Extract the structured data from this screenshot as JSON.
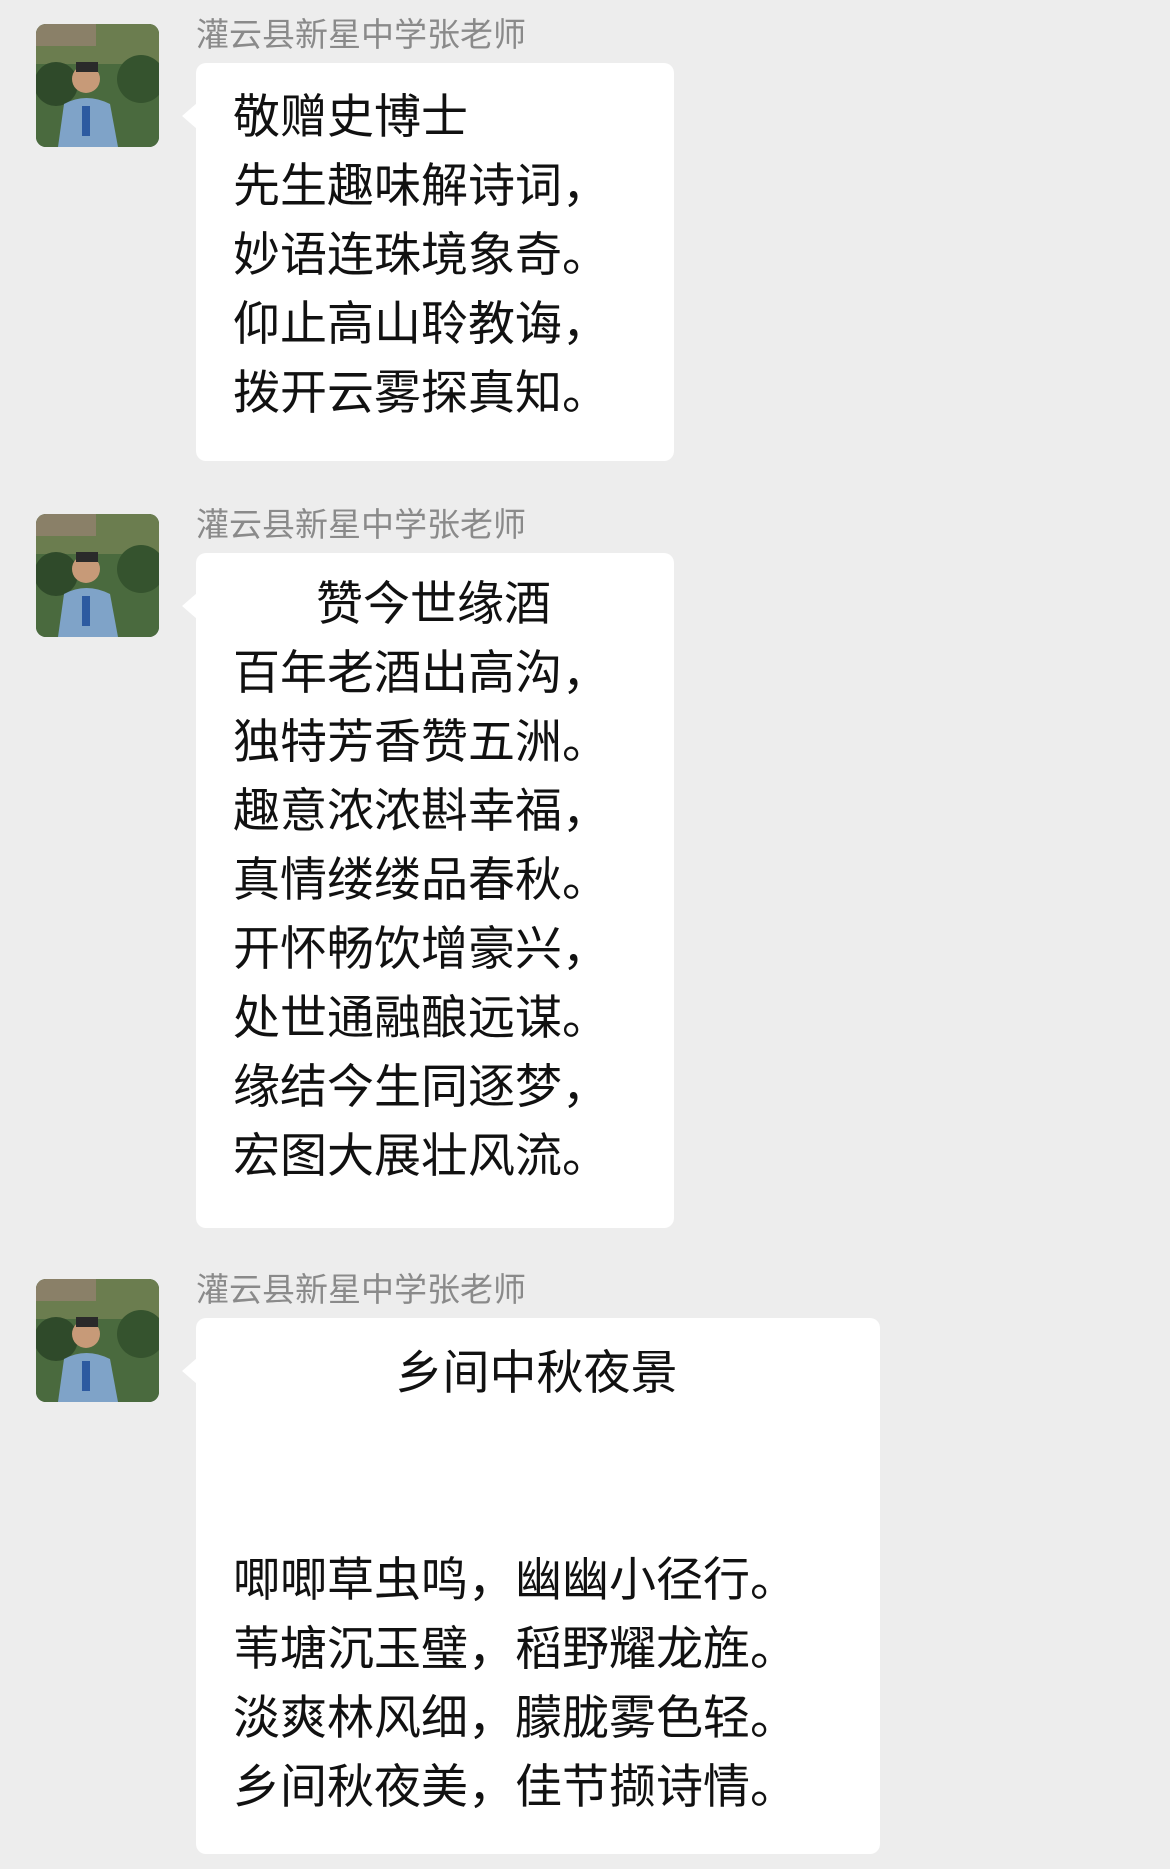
{
  "messages": [
    {
      "sender": "灌云县新星中学张老师",
      "lines": [
        "敬赠史博士",
        "先生趣味解诗词，",
        "妙语连珠境象奇。",
        "仰止高山聆教诲，",
        "拨开云雾探真知。"
      ]
    },
    {
      "sender": "灌云县新星中学张老师",
      "title": "赞今世缘酒",
      "lines": [
        "百年老酒出高沟，",
        "独特芳香赞五洲。",
        "趣意浓浓斟幸福，",
        "真情缕缕品春秋。",
        "开怀畅饮增豪兴，",
        "处世通融酿远谋。",
        "缘结今生同逐梦，",
        "宏图大展壮风流。"
      ]
    },
    {
      "sender": "灌云县新星中学张老师",
      "title": "乡间中秋夜景",
      "lines": [
        "唧唧草虫鸣，幽幽小径行。",
        "苇塘沉玉璧，稻野耀龙旌。",
        "淡爽林风细，朦胧雾色轻。",
        "乡间秋夜美，佳节撷诗情。"
      ]
    }
  ],
  "icons": {
    "avatar": "avatar-photo-icon"
  },
  "colors": {
    "background": "#ededed",
    "bubble": "#ffffff",
    "sender_text": "#8a8a8a",
    "message_text": "#111111"
  }
}
